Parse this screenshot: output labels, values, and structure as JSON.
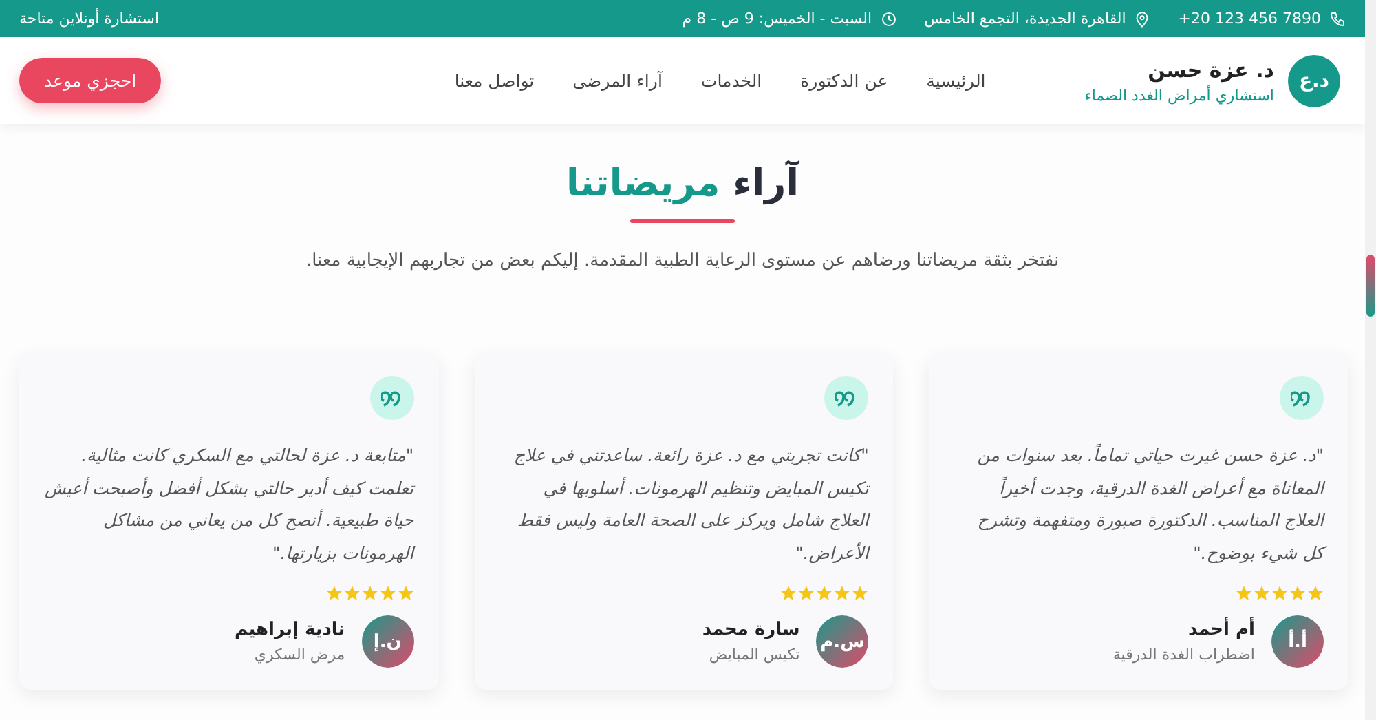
{
  "top_bar": {
    "phone": "+20 123 456 7890",
    "address": "القاهرة الجديدة، التجمع الخامس",
    "hours": "السبت - الخميس: 9 ص - 8 م",
    "online": "استشارة أونلاين متاحة"
  },
  "header": {
    "logo": "د.ع",
    "name": "د. عزة حسن",
    "tagline": "استشاري أمراض الغدد الصماء",
    "nav": [
      {
        "label": "الرئيسية",
        "selected": false
      },
      {
        "label": "عن الدكتورة",
        "selected": false
      },
      {
        "label": "الخدمات",
        "selected": false
      },
      {
        "label": "آراء المرضى",
        "selected": false
      },
      {
        "label": "تواصل معنا",
        "selected": false
      }
    ],
    "cta": "احجزي موعد"
  },
  "section": {
    "title": "آراء",
    "title_highlight": "مريضاتنا",
    "subtitle": "نفتخر بثقة مريضاتنا ورضاهم عن مستوى الرعاية الطبية المقدمة. إليكم بعض من تجاربهم الإيجابية معنا."
  },
  "testimonials": [
    {
      "quote": "\"د. عزة حسن غيرت حياتي تماماً. بعد سنوات من المعاناة مع أعراض الغدة الدرقية، وجدت أخيراً العلاج المناسب. الدكتورة صبورة ومتفهمة وتشرح كل شيء بوضوح.\"",
      "stars": 5,
      "initials": "أ.أ",
      "name": "أم أحمد",
      "condition": "اضطراب الغدة الدرقية"
    },
    {
      "quote": "\"كانت تجربتي مع د. عزة رائعة. ساعدتني في علاج تكيس المبايض وتنظيم الهرمونات. أسلوبها في العلاج شامل ويركز على الصحة العامة وليس فقط الأعراض.\"",
      "stars": 5,
      "initials": "س.م",
      "name": "سارة محمد",
      "condition": "تكيس المبايض"
    },
    {
      "quote": "\"متابعة د. عزة لحالتي مع السكري كانت مثالية. تعلمت كيف أدير حالتي بشكل أفضل وأصبحت أعيش حياة طبيعية. أنصح كل من يعاني من مشاكل الهرمونات بزيارتها.\"",
      "stars": 5,
      "initials": "ن.إ",
      "name": "نادية إبراهيم",
      "condition": "مرض السكري"
    }
  ]
}
